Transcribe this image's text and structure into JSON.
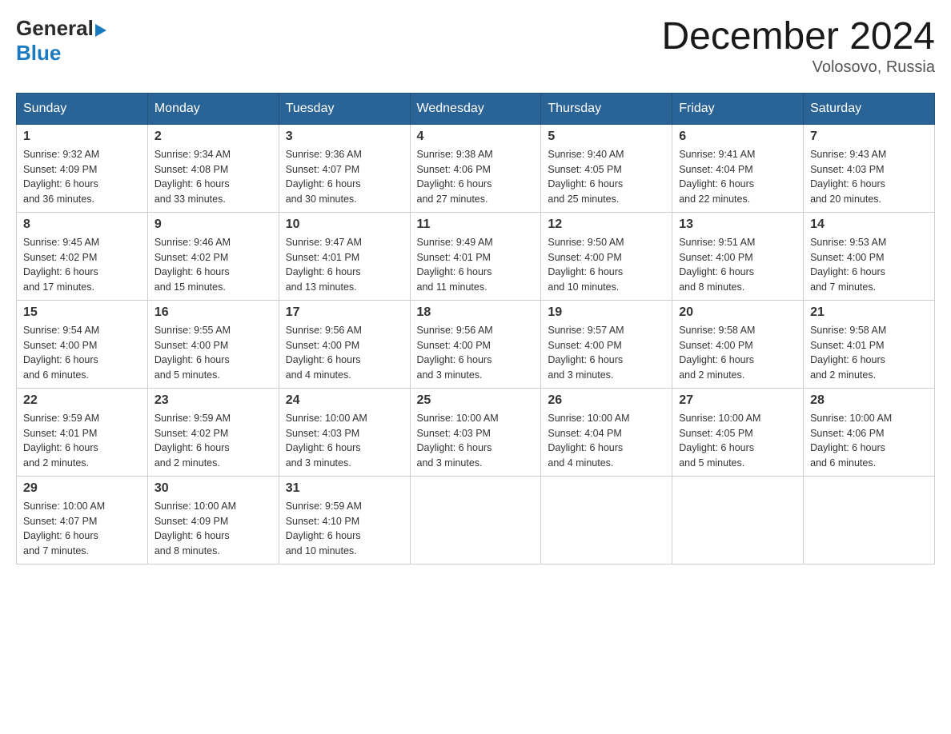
{
  "header": {
    "logo_general": "General",
    "logo_blue": "Blue",
    "month_title": "December 2024",
    "location": "Volosovo, Russia"
  },
  "days_of_week": [
    "Sunday",
    "Monday",
    "Tuesday",
    "Wednesday",
    "Thursday",
    "Friday",
    "Saturday"
  ],
  "weeks": [
    [
      {
        "day": "1",
        "sunrise": "Sunrise: 9:32 AM",
        "sunset": "Sunset: 4:09 PM",
        "daylight": "Daylight: 6 hours",
        "daylight2": "and 36 minutes."
      },
      {
        "day": "2",
        "sunrise": "Sunrise: 9:34 AM",
        "sunset": "Sunset: 4:08 PM",
        "daylight": "Daylight: 6 hours",
        "daylight2": "and 33 minutes."
      },
      {
        "day": "3",
        "sunrise": "Sunrise: 9:36 AM",
        "sunset": "Sunset: 4:07 PM",
        "daylight": "Daylight: 6 hours",
        "daylight2": "and 30 minutes."
      },
      {
        "day": "4",
        "sunrise": "Sunrise: 9:38 AM",
        "sunset": "Sunset: 4:06 PM",
        "daylight": "Daylight: 6 hours",
        "daylight2": "and 27 minutes."
      },
      {
        "day": "5",
        "sunrise": "Sunrise: 9:40 AM",
        "sunset": "Sunset: 4:05 PM",
        "daylight": "Daylight: 6 hours",
        "daylight2": "and 25 minutes."
      },
      {
        "day": "6",
        "sunrise": "Sunrise: 9:41 AM",
        "sunset": "Sunset: 4:04 PM",
        "daylight": "Daylight: 6 hours",
        "daylight2": "and 22 minutes."
      },
      {
        "day": "7",
        "sunrise": "Sunrise: 9:43 AM",
        "sunset": "Sunset: 4:03 PM",
        "daylight": "Daylight: 6 hours",
        "daylight2": "and 20 minutes."
      }
    ],
    [
      {
        "day": "8",
        "sunrise": "Sunrise: 9:45 AM",
        "sunset": "Sunset: 4:02 PM",
        "daylight": "Daylight: 6 hours",
        "daylight2": "and 17 minutes."
      },
      {
        "day": "9",
        "sunrise": "Sunrise: 9:46 AM",
        "sunset": "Sunset: 4:02 PM",
        "daylight": "Daylight: 6 hours",
        "daylight2": "and 15 minutes."
      },
      {
        "day": "10",
        "sunrise": "Sunrise: 9:47 AM",
        "sunset": "Sunset: 4:01 PM",
        "daylight": "Daylight: 6 hours",
        "daylight2": "and 13 minutes."
      },
      {
        "day": "11",
        "sunrise": "Sunrise: 9:49 AM",
        "sunset": "Sunset: 4:01 PM",
        "daylight": "Daylight: 6 hours",
        "daylight2": "and 11 minutes."
      },
      {
        "day": "12",
        "sunrise": "Sunrise: 9:50 AM",
        "sunset": "Sunset: 4:00 PM",
        "daylight": "Daylight: 6 hours",
        "daylight2": "and 10 minutes."
      },
      {
        "day": "13",
        "sunrise": "Sunrise: 9:51 AM",
        "sunset": "Sunset: 4:00 PM",
        "daylight": "Daylight: 6 hours",
        "daylight2": "and 8 minutes."
      },
      {
        "day": "14",
        "sunrise": "Sunrise: 9:53 AM",
        "sunset": "Sunset: 4:00 PM",
        "daylight": "Daylight: 6 hours",
        "daylight2": "and 7 minutes."
      }
    ],
    [
      {
        "day": "15",
        "sunrise": "Sunrise: 9:54 AM",
        "sunset": "Sunset: 4:00 PM",
        "daylight": "Daylight: 6 hours",
        "daylight2": "and 6 minutes."
      },
      {
        "day": "16",
        "sunrise": "Sunrise: 9:55 AM",
        "sunset": "Sunset: 4:00 PM",
        "daylight": "Daylight: 6 hours",
        "daylight2": "and 5 minutes."
      },
      {
        "day": "17",
        "sunrise": "Sunrise: 9:56 AM",
        "sunset": "Sunset: 4:00 PM",
        "daylight": "Daylight: 6 hours",
        "daylight2": "and 4 minutes."
      },
      {
        "day": "18",
        "sunrise": "Sunrise: 9:56 AM",
        "sunset": "Sunset: 4:00 PM",
        "daylight": "Daylight: 6 hours",
        "daylight2": "and 3 minutes."
      },
      {
        "day": "19",
        "sunrise": "Sunrise: 9:57 AM",
        "sunset": "Sunset: 4:00 PM",
        "daylight": "Daylight: 6 hours",
        "daylight2": "and 3 minutes."
      },
      {
        "day": "20",
        "sunrise": "Sunrise: 9:58 AM",
        "sunset": "Sunset: 4:00 PM",
        "daylight": "Daylight: 6 hours",
        "daylight2": "and 2 minutes."
      },
      {
        "day": "21",
        "sunrise": "Sunrise: 9:58 AM",
        "sunset": "Sunset: 4:01 PM",
        "daylight": "Daylight: 6 hours",
        "daylight2": "and 2 minutes."
      }
    ],
    [
      {
        "day": "22",
        "sunrise": "Sunrise: 9:59 AM",
        "sunset": "Sunset: 4:01 PM",
        "daylight": "Daylight: 6 hours",
        "daylight2": "and 2 minutes."
      },
      {
        "day": "23",
        "sunrise": "Sunrise: 9:59 AM",
        "sunset": "Sunset: 4:02 PM",
        "daylight": "Daylight: 6 hours",
        "daylight2": "and 2 minutes."
      },
      {
        "day": "24",
        "sunrise": "Sunrise: 10:00 AM",
        "sunset": "Sunset: 4:03 PM",
        "daylight": "Daylight: 6 hours",
        "daylight2": "and 3 minutes."
      },
      {
        "day": "25",
        "sunrise": "Sunrise: 10:00 AM",
        "sunset": "Sunset: 4:03 PM",
        "daylight": "Daylight: 6 hours",
        "daylight2": "and 3 minutes."
      },
      {
        "day": "26",
        "sunrise": "Sunrise: 10:00 AM",
        "sunset": "Sunset: 4:04 PM",
        "daylight": "Daylight: 6 hours",
        "daylight2": "and 4 minutes."
      },
      {
        "day": "27",
        "sunrise": "Sunrise: 10:00 AM",
        "sunset": "Sunset: 4:05 PM",
        "daylight": "Daylight: 6 hours",
        "daylight2": "and 5 minutes."
      },
      {
        "day": "28",
        "sunrise": "Sunrise: 10:00 AM",
        "sunset": "Sunset: 4:06 PM",
        "daylight": "Daylight: 6 hours",
        "daylight2": "and 6 minutes."
      }
    ],
    [
      {
        "day": "29",
        "sunrise": "Sunrise: 10:00 AM",
        "sunset": "Sunset: 4:07 PM",
        "daylight": "Daylight: 6 hours",
        "daylight2": "and 7 minutes."
      },
      {
        "day": "30",
        "sunrise": "Sunrise: 10:00 AM",
        "sunset": "Sunset: 4:09 PM",
        "daylight": "Daylight: 6 hours",
        "daylight2": "and 8 minutes."
      },
      {
        "day": "31",
        "sunrise": "Sunrise: 9:59 AM",
        "sunset": "Sunset: 4:10 PM",
        "daylight": "Daylight: 6 hours",
        "daylight2": "and 10 minutes."
      },
      null,
      null,
      null,
      null
    ]
  ]
}
